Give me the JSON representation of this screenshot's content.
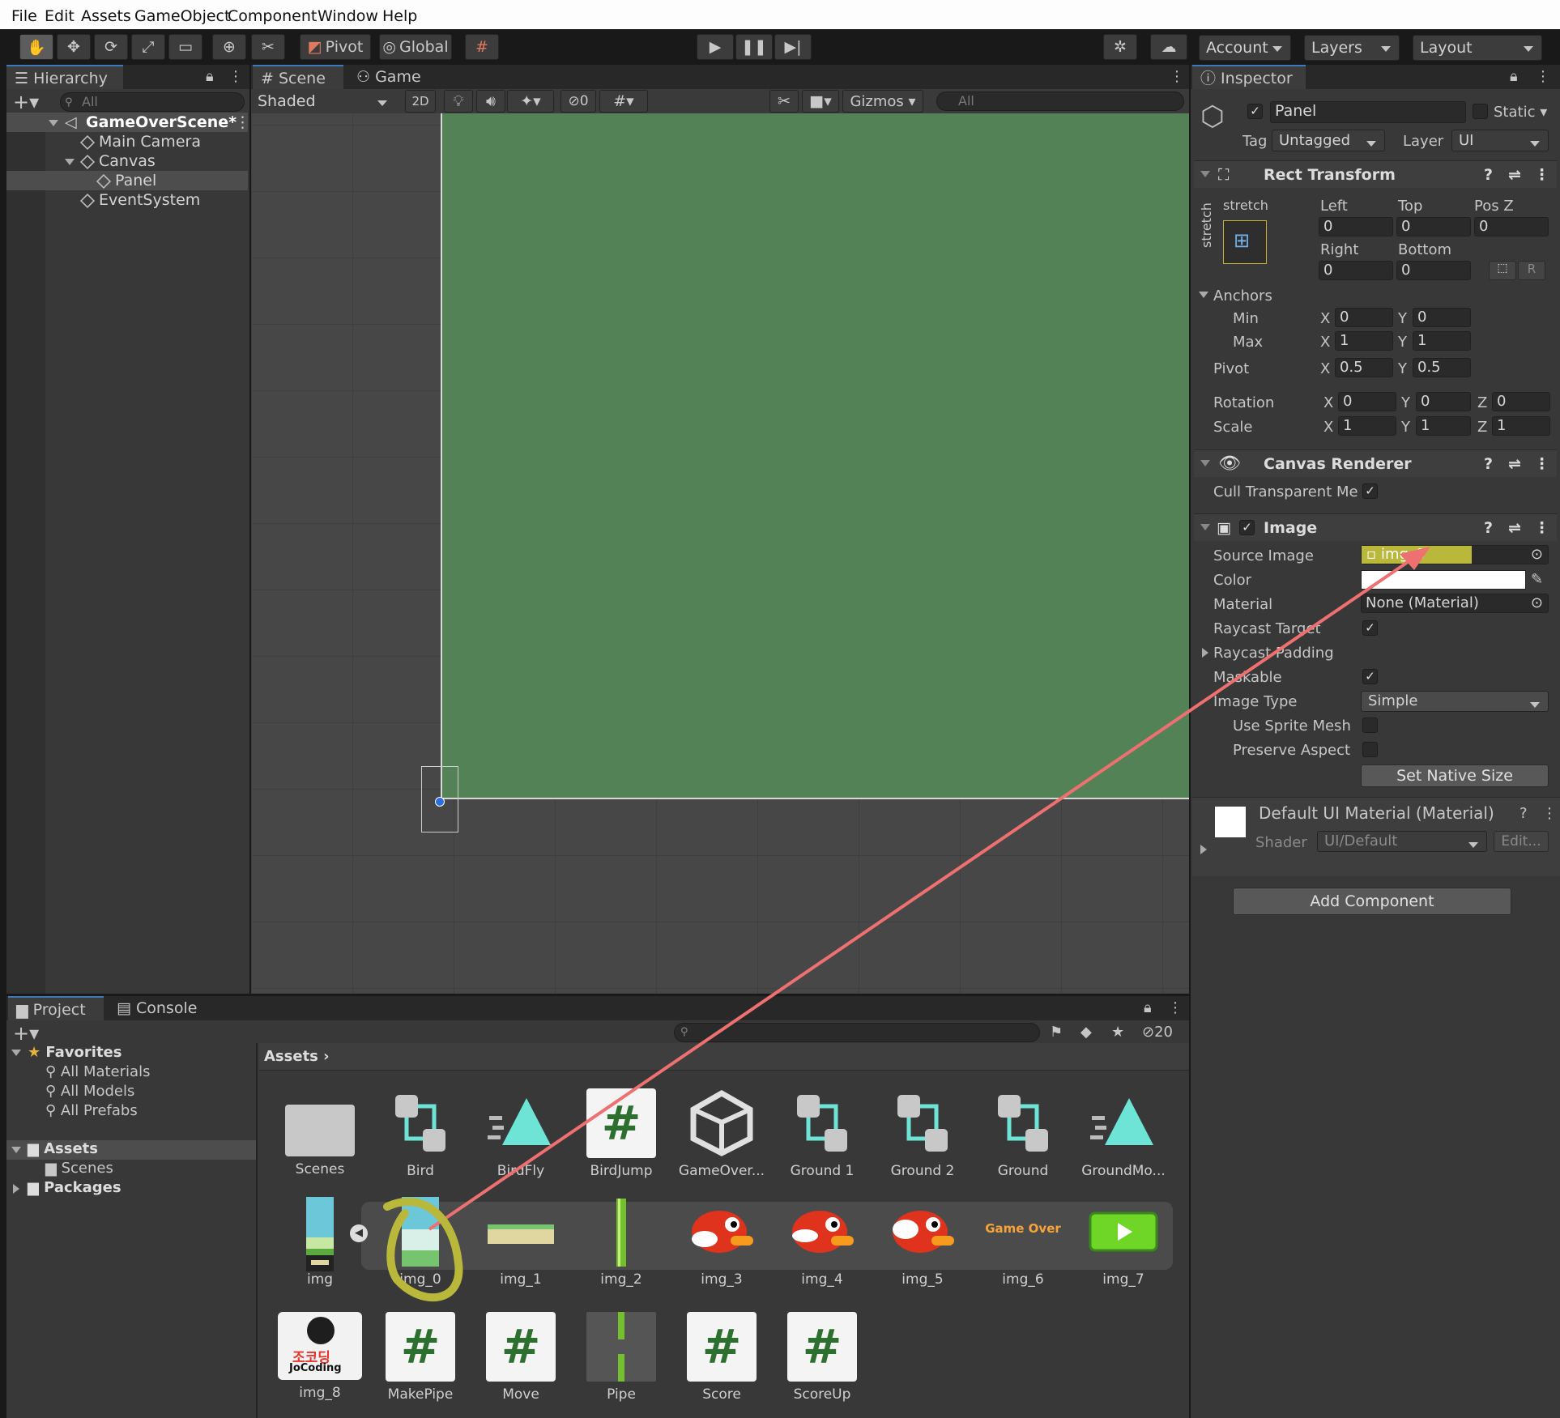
{
  "menu": [
    "File",
    "Edit",
    "Assets",
    "GameObject",
    "Component",
    "Window",
    "Help"
  ],
  "toolbar": {
    "pivot": "Pivot",
    "global": "Global",
    "account": "Account",
    "layers": "Layers",
    "layout": "Layout"
  },
  "hierarchy": {
    "tab": "Hierarchy",
    "search_placeholder": "All",
    "scene": "GameOverScene*",
    "items": [
      "Main Camera",
      "Canvas",
      "Panel",
      "EventSystem"
    ]
  },
  "scene_view": {
    "tab_scene": "Scene",
    "tab_game": "Game",
    "shading": "Shaded",
    "mode_2d": "2D",
    "hidden_count": "0",
    "gizmos": "Gizmos",
    "search_placeholder": "All",
    "panel_color": "#548257"
  },
  "inspector": {
    "tab": "Inspector",
    "object_name": "Panel",
    "static_label": "Static",
    "tag_label": "Tag",
    "tag_value": "Untagged",
    "layer_label": "Layer",
    "layer_value": "UI",
    "rect_transform": {
      "title": "Rect Transform",
      "stretch_h": "stretch",
      "stretch_v": "stretch",
      "left_label": "Left",
      "left": "0",
      "top_label": "Top",
      "top": "0",
      "posz_label": "Pos Z",
      "posz": "0",
      "right_label": "Right",
      "right": "0",
      "bottom_label": "Bottom",
      "bottom": "0",
      "r_button": "R",
      "anchors_label": "Anchors",
      "min_label": "Min",
      "min_x": "0",
      "min_y": "0",
      "max_label": "Max",
      "max_x": "1",
      "max_y": "1",
      "pivot_label": "Pivot",
      "pivot_x": "0.5",
      "pivot_y": "0.5",
      "rotation_label": "Rotation",
      "rot_x": "0",
      "rot_y": "0",
      "rot_z": "0",
      "scale_label": "Scale",
      "scale_x": "1",
      "scale_y": "1",
      "scale_z": "1",
      "x": "X",
      "y": "Y",
      "z": "Z"
    },
    "canvas_renderer": {
      "title": "Canvas Renderer",
      "cull_label": "Cull Transparent Me"
    },
    "image": {
      "title": "Image",
      "source_label": "Source Image",
      "source_value": "img_0",
      "color_label": "Color",
      "material_label": "Material",
      "material_value": "None (Material)",
      "raycast_target": "Raycast Target",
      "raycast_padding": "Raycast Padding",
      "maskable": "Maskable",
      "image_type_label": "Image Type",
      "image_type_value": "Simple",
      "use_sprite_mesh": "Use Sprite Mesh",
      "preserve_aspect": "Preserve Aspect",
      "set_native_size": "Set Native Size"
    },
    "material": {
      "title": "Default UI Material (Material)",
      "shader_label": "Shader",
      "shader_value": "UI/Default",
      "edit": "Edit..."
    },
    "add_component": "Add Component"
  },
  "project": {
    "tab_project": "Project",
    "tab_console": "Console",
    "hidden_count": "20",
    "favorites": "Favorites",
    "fav_items": [
      "All Materials",
      "All Models",
      "All Prefabs"
    ],
    "assets": "Assets",
    "scenes": "Scenes",
    "packages": "Packages",
    "breadcrumb": "Assets",
    "row1": [
      "Scenes",
      "Bird",
      "BirdFly",
      "BirdJump",
      "GameOver...",
      "Ground 1",
      "Ground 2",
      "Ground",
      "GroundMo..."
    ],
    "row2": [
      "img",
      "img_0",
      "img_1",
      "img_2",
      "img_3",
      "img_4",
      "img_5",
      "img_6",
      "img_7"
    ],
    "row3": [
      "img_8",
      "MakePipe",
      "Move",
      "Pipe",
      "Score",
      "ScoreUp"
    ],
    "game_over_text": "Game Over",
    "jocoding_text": "JoCoding",
    "jocoding_kr": "조코딩"
  },
  "colors": {
    "accent_blue": "#3a79bb",
    "annotation_red": "#ee7070",
    "annotation_yellow": "#b9b83a",
    "turquoise": "#6de4d6"
  }
}
